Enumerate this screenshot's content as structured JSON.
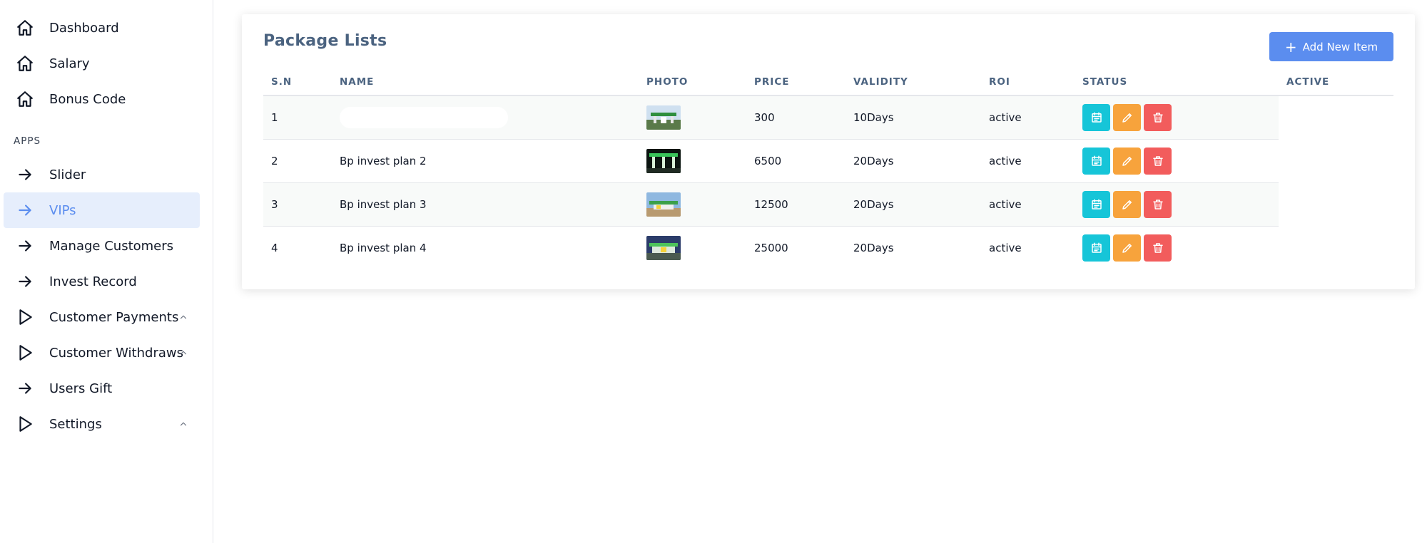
{
  "sidebar": {
    "top_items": [
      {
        "label": "Dashboard",
        "icon": "home-icon"
      },
      {
        "label": "Salary",
        "icon": "home-icon"
      },
      {
        "label": "Bonus Code",
        "icon": "home-icon"
      }
    ],
    "section_label": "APPS",
    "app_items": [
      {
        "label": "Slider",
        "icon": "arrow-right-icon"
      },
      {
        "label": "VIPs",
        "icon": "arrow-right-icon",
        "active": true
      },
      {
        "label": "Manage Customers",
        "icon": "arrow-right-icon"
      },
      {
        "label": "Invest Record",
        "icon": "arrow-right-icon"
      },
      {
        "label": "Customer Payments",
        "icon": "play-icon",
        "chevron": "chevron-up-icon"
      },
      {
        "label": "Customer Withdraws",
        "icon": "play-icon",
        "chevron": "chevron-up-icon"
      },
      {
        "label": "Users Gift",
        "icon": "arrow-right-icon"
      },
      {
        "label": "Settings",
        "icon": "play-icon",
        "chevron": "chevron-up-icon"
      }
    ]
  },
  "card": {
    "title": "Package Lists",
    "add_button_label": "Add New Item"
  },
  "table": {
    "columns": [
      "S.N",
      "NAME",
      "PHOTO",
      "PRICE",
      "VALIDITY",
      "ROI",
      "STATUS",
      "ACTIVE"
    ],
    "rows": [
      {
        "sn": "1",
        "name": "",
        "price": "300",
        "validity": "10Days",
        "status": "active"
      },
      {
        "sn": "2",
        "name": "Bp invest plan 2",
        "price": "6500",
        "validity": "20Days",
        "status": "active"
      },
      {
        "sn": "3",
        "name": "Bp invest plan 3",
        "price": "12500",
        "validity": "20Days",
        "status": "active"
      },
      {
        "sn": "4",
        "name": "Bp invest plan 4",
        "price": "25000",
        "validity": "20Days",
        "status": "active"
      }
    ]
  },
  "colors": {
    "accent": "#5b8def",
    "active_bg": "#e6eefc",
    "cyan": "#16c5d8",
    "orange": "#f7a33c",
    "red": "#f25c5c",
    "header_text": "#4b6380"
  }
}
